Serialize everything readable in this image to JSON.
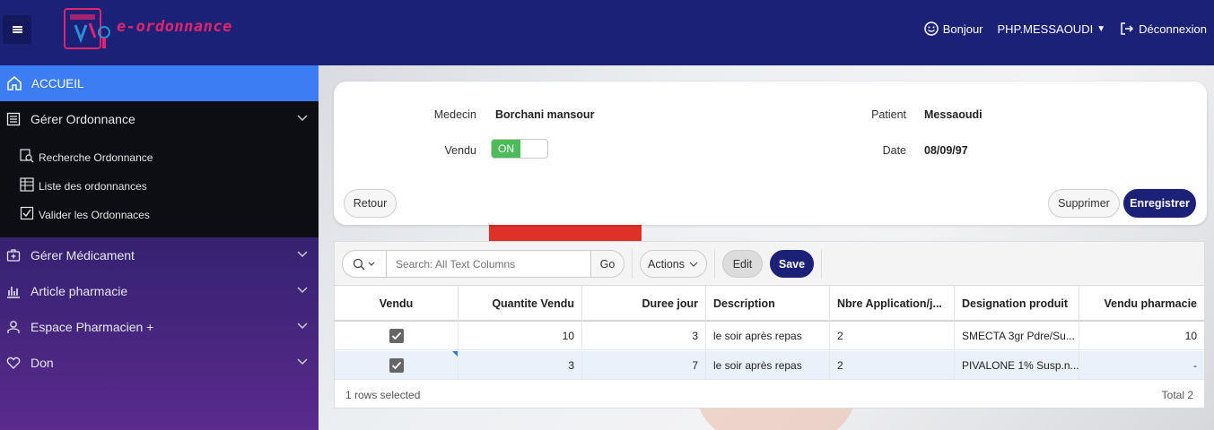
{
  "header": {
    "logo_text": "e-ordonnance",
    "greeting": "Bonjour",
    "user": "PHP.MESSAOUDI",
    "logout": "Déconnexion"
  },
  "sidebar": {
    "accueil": "ACCUEIL",
    "items": [
      {
        "label": "Gérer Ordonnance",
        "icon": "list-icon"
      },
      {
        "label": "Gérer Médicament",
        "icon": "medkit-icon"
      },
      {
        "label": "Article pharmacie",
        "icon": "chart-icon"
      },
      {
        "label": "Espace Pharmacien +",
        "icon": "user-icon"
      },
      {
        "label": "Don",
        "icon": "heart-icon"
      }
    ],
    "subitems": [
      {
        "label": "Recherche Ordonnance",
        "icon": "search-doc-icon"
      },
      {
        "label": "Liste des ordonnances",
        "icon": "table-icon"
      },
      {
        "label": "Valider les Ordonnaces",
        "icon": "checkbox-icon"
      }
    ]
  },
  "form": {
    "medecin_label": "Medecin",
    "medecin_value": "Borchani mansour",
    "patient_label": "Patient",
    "patient_value": "Messaoudi",
    "vendu_label": "Vendu",
    "vendu_toggle": "ON",
    "date_label": "Date",
    "date_value": "08/09/97",
    "btn_retour": "Retour",
    "btn_supprimer": "Supprimer",
    "btn_enregistrer": "Enregistrer"
  },
  "grid": {
    "search_placeholder": "Search: All Text Columns",
    "btn_go": "Go",
    "btn_actions": "Actions",
    "btn_edit": "Edit",
    "btn_save": "Save",
    "columns": [
      "Vendu",
      "Quantite Vendu",
      "Duree jour",
      "Description",
      "Nbre Application/j...",
      "Designation produit",
      "Vendu pharmacie"
    ],
    "rows": [
      {
        "vendu": true,
        "quantite": "10",
        "duree": "3",
        "description": "le soir après repas",
        "nbre": "2",
        "designation": "SMECTA 3gr Pdre/Su...",
        "vendu_pharmacie": "10"
      },
      {
        "vendu": true,
        "quantite": "3",
        "duree": "7",
        "description": "le soir après repas",
        "nbre": "2",
        "designation": "PIVALONE 1% Susp.n...",
        "vendu_pharmacie": "-"
      }
    ],
    "footer_left": "1 rows selected",
    "footer_right": "Total 2"
  }
}
